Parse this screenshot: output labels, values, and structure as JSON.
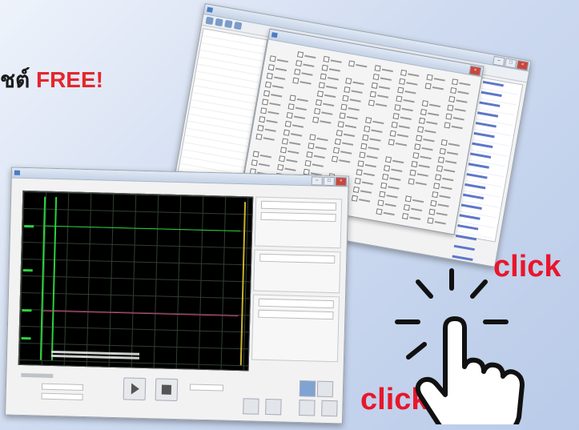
{
  "headline": {
    "prefix": "ชต์",
    "highlight": "FREE!"
  },
  "callouts": {
    "click_top": "click",
    "click_bottom": "click"
  },
  "colors": {
    "accent_red": "#e8162b",
    "trace_green": "#2bd13d",
    "scope_background": "#000000"
  },
  "icons": {
    "hand": "pointing-hand-icon",
    "burst": "click-burst-icon"
  }
}
